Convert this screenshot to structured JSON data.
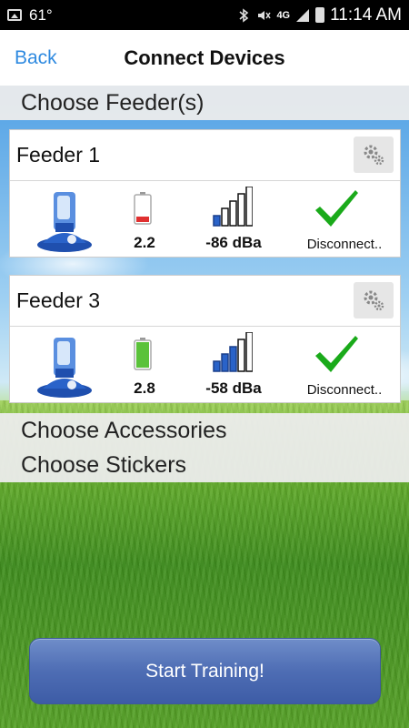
{
  "status_bar": {
    "temperature": "61°",
    "network": "4G",
    "time": "11:14 AM"
  },
  "nav": {
    "back_label": "Back",
    "title": "Connect Devices"
  },
  "sections": {
    "feeders": "Choose Feeder(s)",
    "accessories": "Choose Accessories",
    "stickers": "Choose Stickers"
  },
  "feeders": [
    {
      "name": "Feeder 1",
      "battery_value": "2.2",
      "battery_level": 0.2,
      "battery_color": "#e03030",
      "signal_value": "-86 dBa",
      "signal_bars_active": 1,
      "status": "Disconnect.."
    },
    {
      "name": "Feeder 3",
      "battery_value": "2.8",
      "battery_level": 1.0,
      "battery_color": "#5ac23a",
      "signal_value": "-58 dBa",
      "signal_bars_active": 3,
      "status": "Disconnect.."
    }
  ],
  "start_button": "Start Training!",
  "colors": {
    "accent": "#2f8ae0",
    "check": "#1aaa1a",
    "signal_active": "#2a63c9",
    "button": "#4e6db4"
  }
}
